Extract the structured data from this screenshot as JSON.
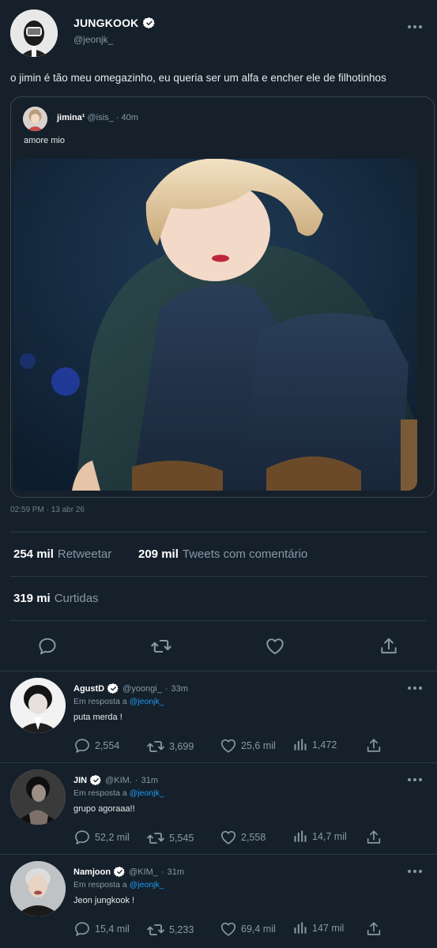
{
  "tweet": {
    "author_name": "JUNGKOOK",
    "author_handle": "@jeonjk_",
    "text": "o jimin é tão meu omegazinho, eu queria ser um alfa e encher ele de filhotinhos",
    "timestamp": "02:59 PM · 13 abr 26",
    "quote": {
      "author_name": "jimina¹",
      "author_handle": "@isis_",
      "time": "40m",
      "text": "amore mio"
    },
    "stats": {
      "retweets_count": "254 mil",
      "retweets_label": "Retweetar",
      "quotes_count": "209 mil",
      "quotes_label": "Tweets com comentário",
      "likes_count": "319 mi",
      "likes_label": "Curtidas"
    },
    "actions": [
      "reply-icon",
      "retweet-icon",
      "heart-icon",
      "share-icon"
    ]
  },
  "reply_prefix": "Em resposta a",
  "reply_target": "@jeonjk_",
  "replies": [
    {
      "name": "AgustD",
      "handle": "@yoongi_",
      "time": "33m",
      "text": "puta merda !",
      "comments": "2,554",
      "retweets": "3,699",
      "likes": "25,6 mil",
      "views": "1,472"
    },
    {
      "name": "JIN",
      "handle": "@KIM.",
      "time": "31m",
      "text": "grupo agoraaa!!",
      "comments": "52,2 mil",
      "retweets": "5,545",
      "likes": "2,558",
      "views": "14,7 mil"
    },
    {
      "name": "Namjoon",
      "handle": "@KIM_",
      "time": "31m",
      "text": "Jeon jungkook !",
      "comments": "15,4 mil",
      "retweets": "5,233",
      "likes": "69,4 mil",
      "views": "147 mil"
    }
  ],
  "colors": {
    "background": "#15202b",
    "accent": "#1d9bf0",
    "secondary_text": "#8899a6",
    "divider": "#2c3a46"
  }
}
